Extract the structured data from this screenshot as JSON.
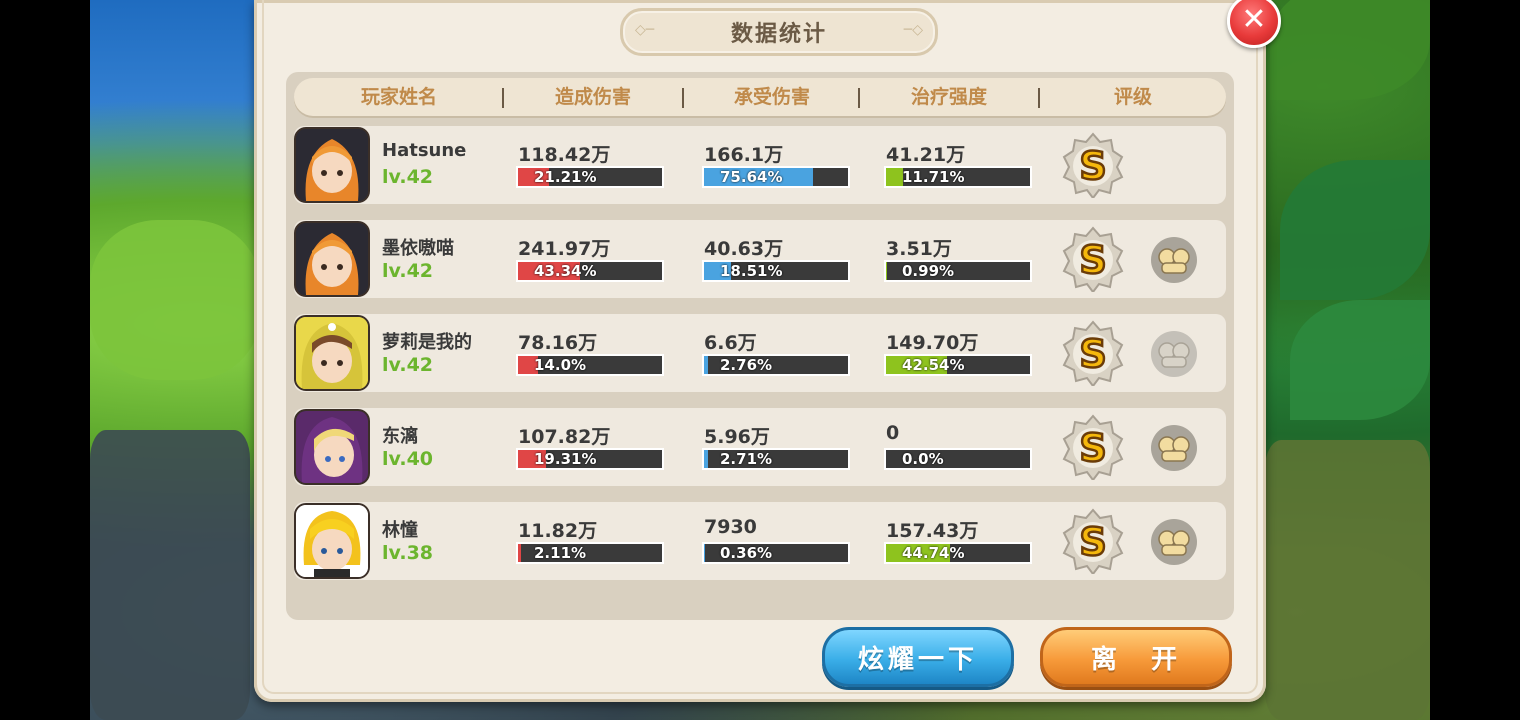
{
  "window": {
    "title": "数据统计"
  },
  "headers": [
    "玩家姓名",
    "造成伤害",
    "承受伤害",
    "治疗强度",
    "评级"
  ],
  "players": [
    {
      "name": "Hatsune",
      "level": "lv.42",
      "dmg": "118.42万",
      "dmg_pct": "21.21%",
      "dmg_ratio": 0.2121,
      "taken": "166.1万",
      "taken_pct": "75.64%",
      "taken_ratio": 0.7564,
      "heal": "41.21万",
      "heal_pct": "11.71%",
      "heal_ratio": 0.1171,
      "grade": "S",
      "like": "none",
      "avatar": "orange-hair-hooded"
    },
    {
      "name": "墨依嗷喵",
      "level": "lv.42",
      "dmg": "241.97万",
      "dmg_pct": "43.34%",
      "dmg_ratio": 0.4334,
      "taken": "40.63万",
      "taken_pct": "18.51%",
      "taken_ratio": 0.1851,
      "heal": "3.51万",
      "heal_pct": "0.99%",
      "heal_ratio": 0.0099,
      "grade": "S",
      "like": "active",
      "avatar": "orange-hair-hooded"
    },
    {
      "name": "萝莉是我的",
      "level": "lv.42",
      "dmg": "78.16万",
      "dmg_pct": "14.0%",
      "dmg_ratio": 0.14,
      "taken": "6.6万",
      "taken_pct": "2.76%",
      "taken_ratio": 0.0276,
      "heal": "149.70万",
      "heal_pct": "42.54%",
      "heal_ratio": 0.4254,
      "grade": "S",
      "like": "dim",
      "avatar": "yellow-hood-brown-hair"
    },
    {
      "name": "东漓",
      "level": "lv.40",
      "dmg": "107.82万",
      "dmg_pct": "19.31%",
      "dmg_ratio": 0.1931,
      "taken": "5.96万",
      "taken_pct": "2.71%",
      "taken_ratio": 0.0271,
      "heal": "0",
      "heal_pct": "0.0%",
      "heal_ratio": 0,
      "grade": "S",
      "like": "active",
      "avatar": "purple-hood-blonde"
    },
    {
      "name": "林憧",
      "level": "lv.38",
      "dmg": "11.82万",
      "dmg_pct": "2.11%",
      "dmg_ratio": 0.0211,
      "taken": "7930",
      "taken_pct": "0.36%",
      "taken_ratio": 0.0036,
      "heal": "157.43万",
      "heal_pct": "44.74%",
      "heal_ratio": 0.4474,
      "grade": "S",
      "like": "active",
      "avatar": "blonde-boy"
    }
  ],
  "buttons": {
    "show_off": "炫耀一下",
    "leave": "离　开"
  },
  "colors": {
    "damage": "#e04646",
    "taken": "#4aa3e0",
    "heal": "#8ec31e",
    "level": "#6cb52e"
  }
}
